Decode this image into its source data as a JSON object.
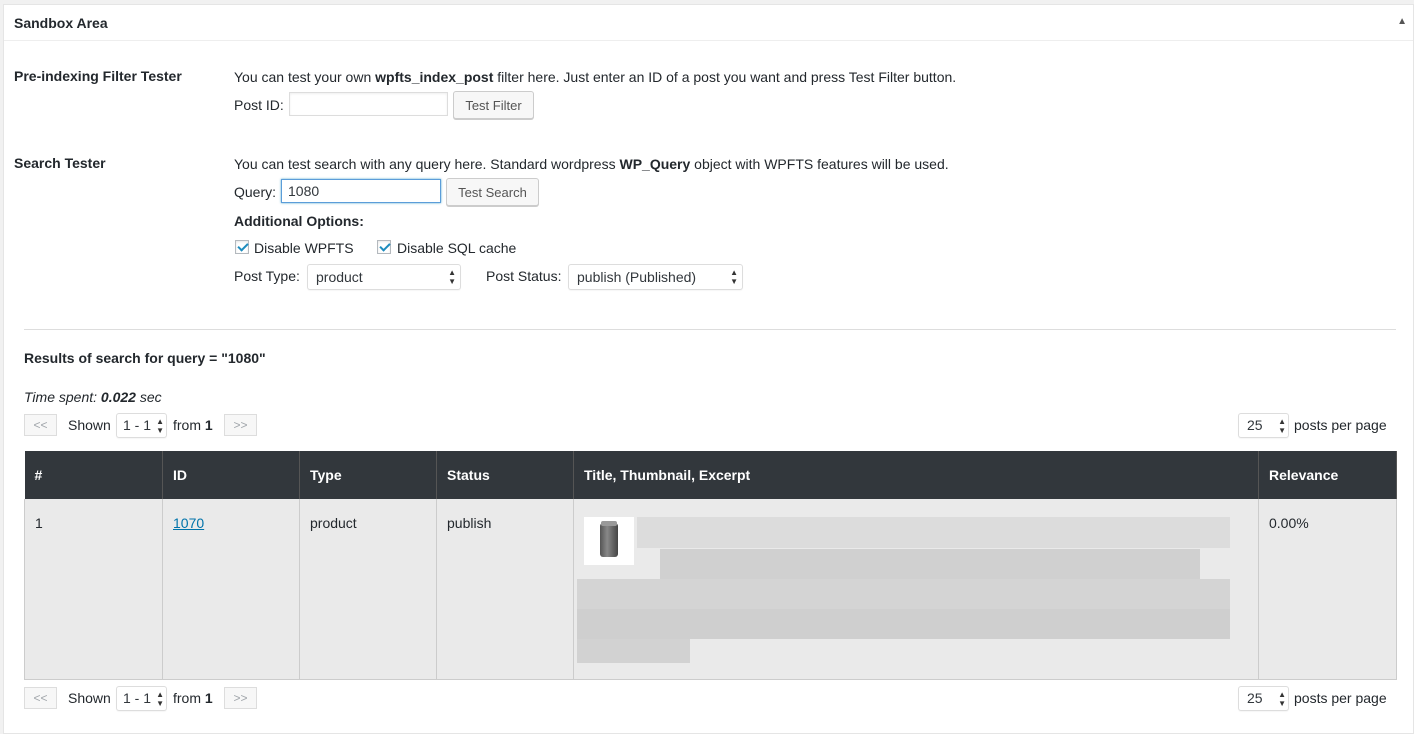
{
  "box": {
    "title": "Sandbox Area"
  },
  "pre_index": {
    "label": "Pre-indexing Filter Tester",
    "desc_before": "You can test your own ",
    "desc_strong": "wpfts_index_post",
    "desc_after": " filter here. Just enter an ID of a post you want and press Test Filter button.",
    "post_id_label": "Post ID:",
    "post_id_value": "",
    "button": "Test Filter"
  },
  "search": {
    "label": "Search Tester",
    "desc_before": "You can test search with any query here. Standard wordpress ",
    "desc_strong": "WP_Query",
    "desc_after": " object with WPFTS features will be used.",
    "query_label": "Query:",
    "query_value": "1080",
    "button": "Test Search",
    "additional_options": "Additional Options:",
    "disable_wpfts": "Disable WPFTS",
    "disable_sql_cache": "Disable SQL cache",
    "post_type_label": "Post Type:",
    "post_type_value": "product",
    "post_status_label": "Post Status:",
    "post_status_value": "publish (Published)"
  },
  "results": {
    "heading": "Results of search for query = \"1080\"",
    "time_label": "Time spent: ",
    "time_value": "0.022",
    "time_unit": " sec",
    "pager": {
      "prev": "<<",
      "next": ">>",
      "shown_label": "Shown",
      "range": "1 - 1",
      "from_label": "from",
      "total_pages": "1",
      "per_page": "25",
      "per_page_label": "posts per page"
    },
    "columns": [
      "#",
      "ID",
      "Type",
      "Status",
      "Title, Thumbnail, Excerpt",
      "Relevance"
    ],
    "rows": [
      {
        "num": "1",
        "id": "1070",
        "type": "product",
        "status": "publish",
        "relevance": "0.00%"
      }
    ]
  },
  "icons": {
    "toggle": "triangle-up-icon",
    "checkbox": "checkmark-icon",
    "select": "select-arrows-icon"
  },
  "colors": {
    "header_bg": "#32373c",
    "link": "#0073aa",
    "checkbox": "#1e8cbe"
  }
}
